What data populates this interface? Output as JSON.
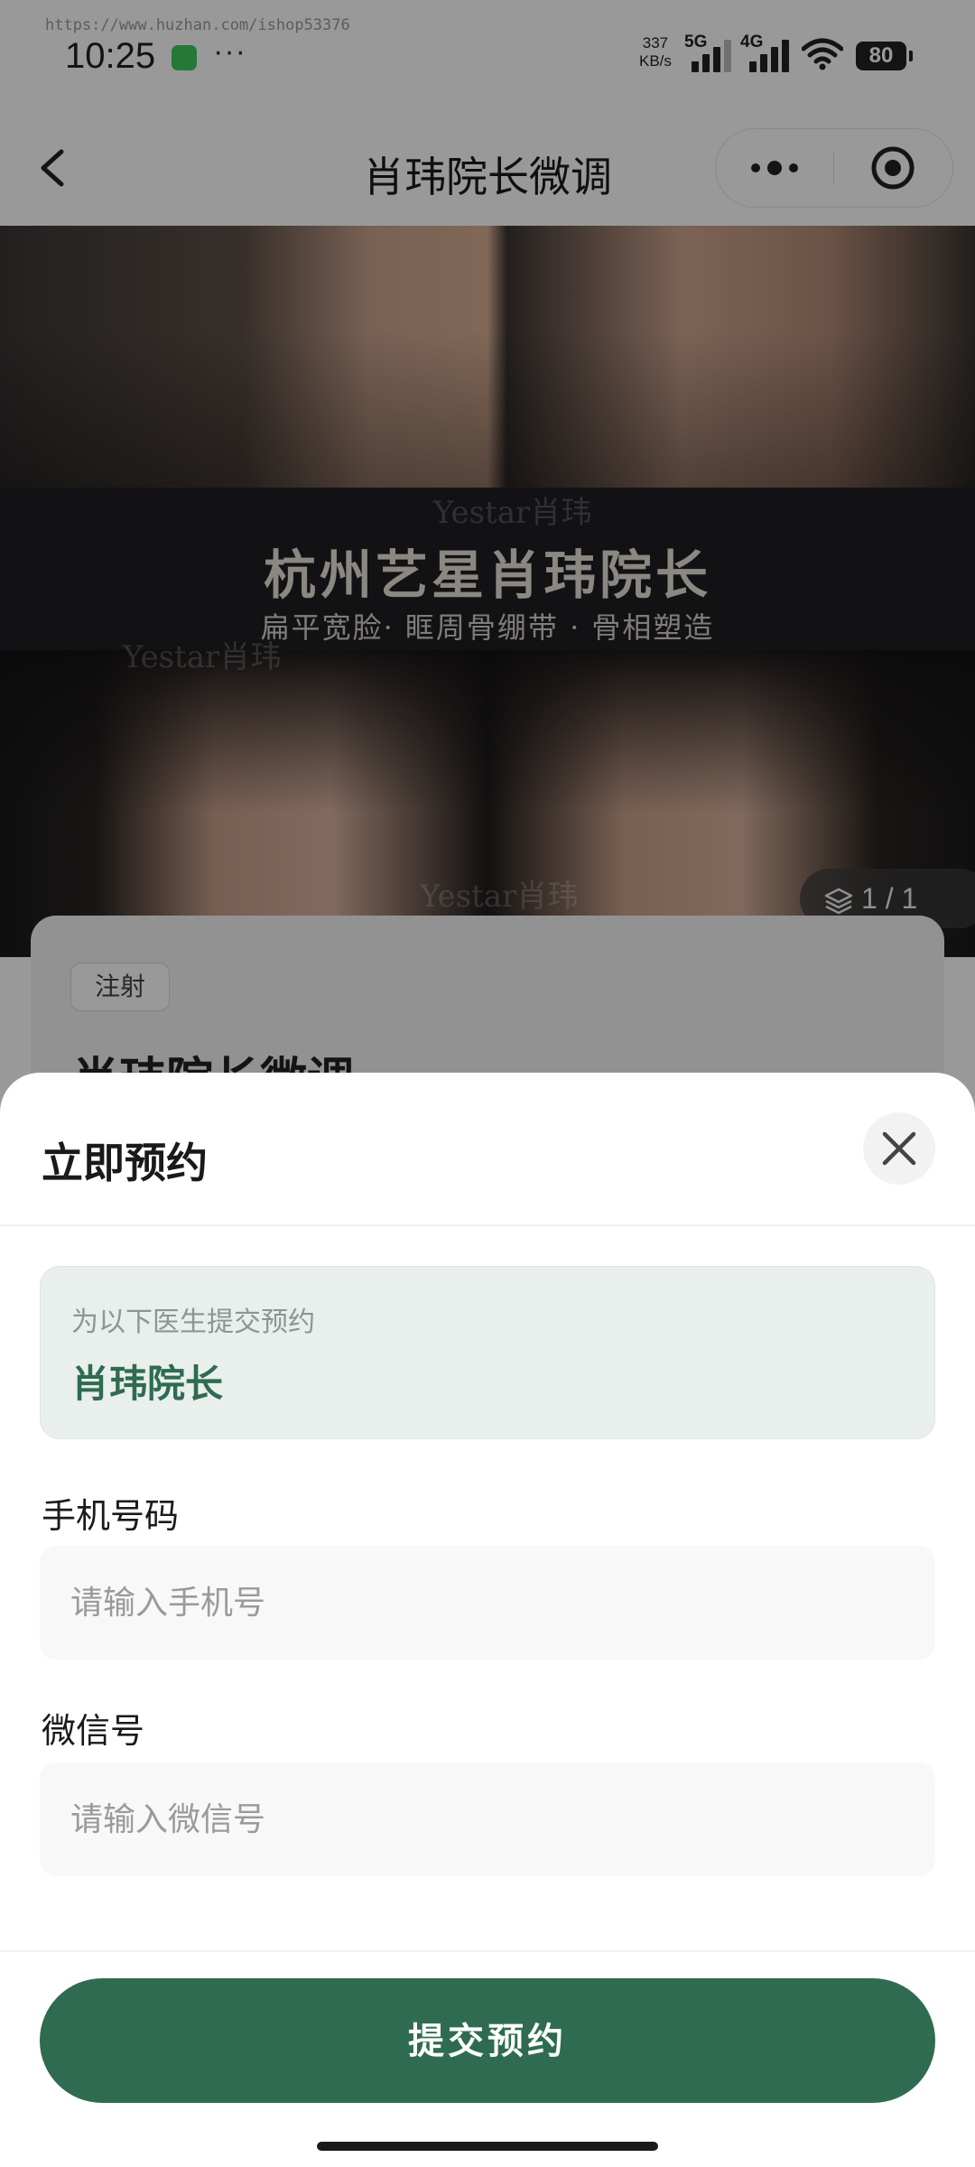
{
  "status_bar": {
    "watermark": "https://www.huzhan.com/ishop53376",
    "time": "10:25",
    "more": "···",
    "speed_value": "337",
    "speed_unit": "KB/s",
    "net1": "5G",
    "net2": "4G",
    "battery": "80"
  },
  "nav": {
    "title": "肖玮院长微调"
  },
  "hero": {
    "title": "杭州艺星肖玮院长",
    "subtitle": "扁平宽脸· 眶周骨绷带 · 骨相塑造",
    "watermark": "Yestar肖玮",
    "page_indicator": "1 / 1"
  },
  "card": {
    "tag": "注射",
    "title": "肖玮院长微调"
  },
  "sheet": {
    "title": "立即预约",
    "doctor_hint": "为以下医生提交预约",
    "doctor_name": "肖玮院长",
    "phone_label": "手机号码",
    "phone_placeholder": "请输入手机号",
    "wechat_label": "微信号",
    "wechat_placeholder": "请输入微信号",
    "submit_label": "提交预约"
  },
  "colors": {
    "brand_green": "#2f6b50",
    "doctor_box_bg": "#e8efec"
  }
}
